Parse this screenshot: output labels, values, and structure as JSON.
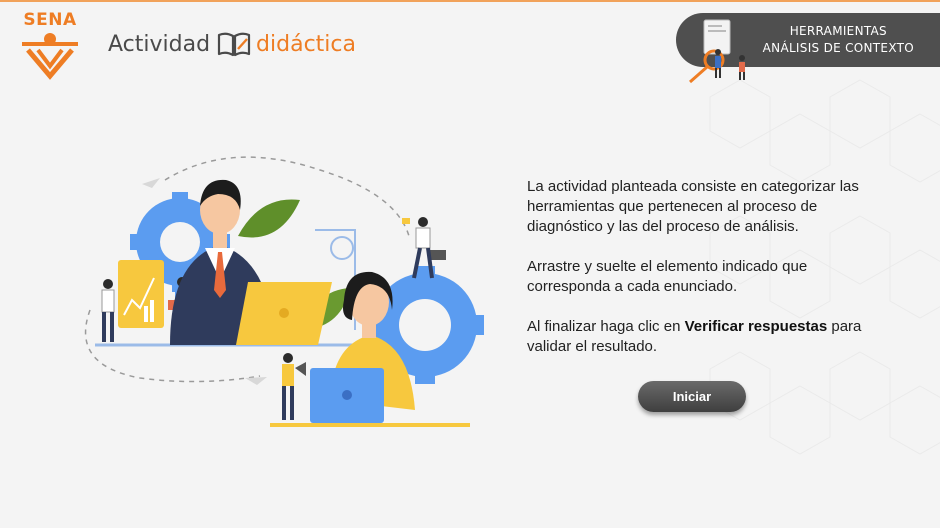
{
  "header": {
    "logo_text": "SENA",
    "title_part1": "Actividad",
    "title_part2": "didáctica",
    "badge_line1": "HERRAMIENTAS",
    "badge_line2": "ANÁLISIS DE CONTEXTO"
  },
  "content": {
    "paragraph1": "La actividad planteada consiste en categorizar las herramientas que pertenecen al proceso de diagnóstico y las del proceso de análisis.",
    "paragraph2": "Arrastre y suelte el elemento indicado que corresponda a cada enunciado.",
    "paragraph3_prefix": "Al finalizar haga clic en ",
    "paragraph3_bold": "Verificar respuestas",
    "paragraph3_suffix": " para validar el resultado."
  },
  "actions": {
    "start_label": "Iniciar"
  },
  "colors": {
    "brand_orange": "#ee7d24",
    "badge_gray": "#4f4f4f",
    "gear_blue": "#5b9cf0",
    "accent_yellow": "#f7c83e",
    "leaf_green": "#5f8f2a"
  },
  "icons": {
    "logo": "sena-logo-icon",
    "book": "book-pencil-icon",
    "badge_art": "magnifier-people-icon"
  }
}
